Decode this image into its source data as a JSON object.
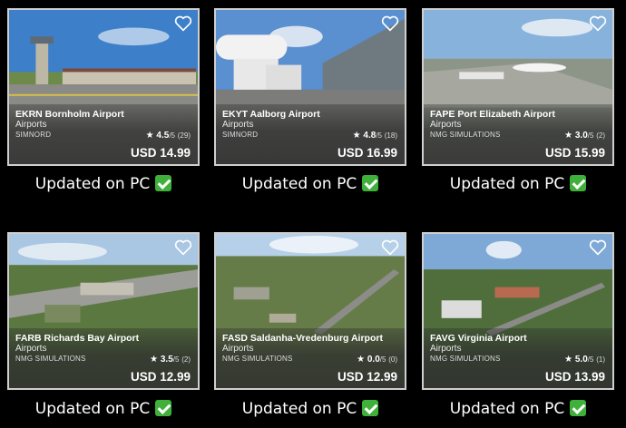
{
  "cards": [
    {
      "title": "EKRN Bornholm Airport",
      "category": "Airports",
      "developer": "SIMNORD",
      "rating": "4.5",
      "rating_max": "/5",
      "rating_count": "(29)",
      "price": "USD 14.99",
      "status": "Updated on PC"
    },
    {
      "title": "EKYT Aalborg Airport",
      "category": "Airports",
      "developer": "SIMNORD",
      "rating": "4.8",
      "rating_max": "/5",
      "rating_count": "(18)",
      "price": "USD 16.99",
      "status": "Updated on PC"
    },
    {
      "title": "FAPE Port Elizabeth Airport",
      "category": "Airports",
      "developer": "NMG SIMULATIONS",
      "rating": "3.0",
      "rating_max": "/5",
      "rating_count": "(2)",
      "price": "USD 15.99",
      "status": "Updated on PC"
    },
    {
      "title": "FARB Richards Bay Airport",
      "category": "Airports",
      "developer": "NMG SIMULATIONS",
      "rating": "3.5",
      "rating_max": "/5",
      "rating_count": "(2)",
      "price": "USD 12.99",
      "status": "Updated on PC"
    },
    {
      "title": "FASD Saldanha-Vredenburg Airport",
      "category": "Airports",
      "developer": "NMG SIMULATIONS",
      "rating": "0.0",
      "rating_max": "/5",
      "rating_count": "(0)",
      "price": "USD 12.99",
      "status": "Updated on PC"
    },
    {
      "title": "FAVG Virginia Airport",
      "category": "Airports",
      "developer": "NMG SIMULATIONS",
      "rating": "5.0",
      "rating_max": "/5",
      "rating_count": "(1)",
      "price": "USD 13.99",
      "status": "Updated on PC"
    }
  ],
  "icons": {
    "favorite": "heart-outline-icon",
    "rating": "star-icon",
    "status": "check-mark-icon"
  },
  "colors": {
    "check_green": "#3fb13b",
    "background": "#000000"
  }
}
